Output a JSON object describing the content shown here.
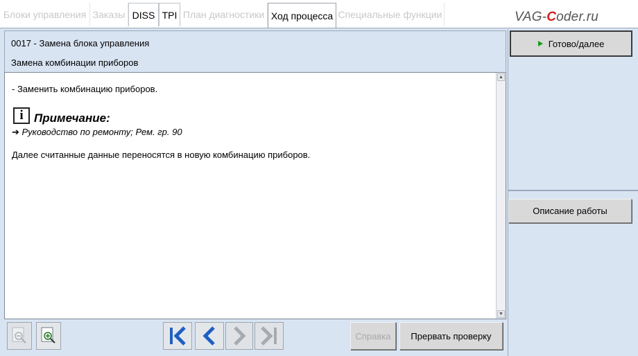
{
  "tabs": [
    {
      "label": "Блоки управления",
      "active": false
    },
    {
      "label": "Заказы",
      "active": false
    },
    {
      "label": "DISS",
      "active": false,
      "enabled": true
    },
    {
      "label": "TPI",
      "active": false,
      "enabled": true
    },
    {
      "label": "План диагностики",
      "active": false
    },
    {
      "label": "Ход процесса",
      "active": true
    },
    {
      "label": "Специальные функции",
      "active": false
    }
  ],
  "watermark": {
    "pre": "VAG-",
    "mark": "C",
    "post": "oder.ru"
  },
  "header": {
    "line1": "0017 - Замена блока управления",
    "line2": "Замена комбинации приборов"
  },
  "content": {
    "step": "- Заменить комбинацию приборов.",
    "note_icon": "info-icon",
    "note_title": "Примечание:",
    "note_link": "➔ Руководство по ремонту; Рем. гр. 90",
    "text": "Далее считанные данные переносятся в новую комбинацию приборов."
  },
  "side": {
    "done_label": "Готово/далее",
    "describe_label": "Описание работы"
  },
  "toolbar": {
    "help_label": "Справка",
    "abort_label": "Прервать проверку",
    "icons": [
      "zoom-out-icon",
      "zoom-in-icon",
      "first-step-icon",
      "back-icon",
      "forward-icon",
      "last-step-icon"
    ]
  },
  "colors": {
    "panel_bg": "#d8e4f2",
    "nav_blue": "#1f5fc4",
    "nav_disabled": "#a7abb0",
    "play_green": "#169a16"
  }
}
